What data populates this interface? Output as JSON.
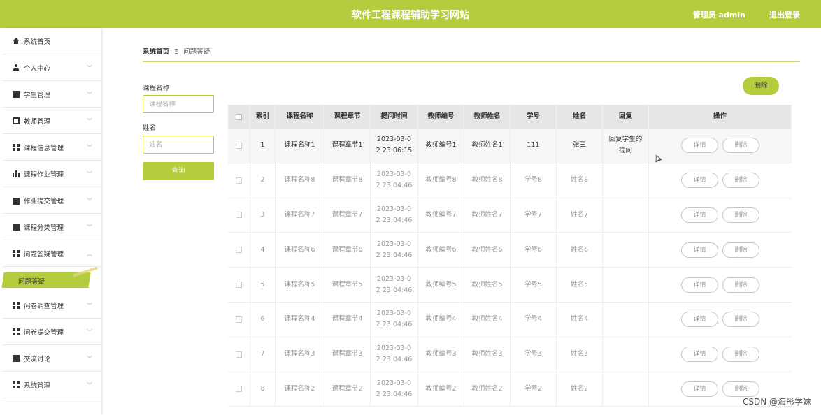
{
  "header": {
    "title": "软件工程课程辅助学习网站",
    "admin_label": "管理员 admin",
    "logout_label": "退出登录"
  },
  "sidebar": {
    "items": [
      {
        "label": "系统首页"
      },
      {
        "label": "个人中心"
      },
      {
        "label": "学生管理"
      },
      {
        "label": "教师管理"
      },
      {
        "label": "课程信息管理"
      },
      {
        "label": "课程作业管理"
      },
      {
        "label": "作业提交管理"
      },
      {
        "label": "课程分类管理"
      },
      {
        "label": "问题答疑管理"
      },
      {
        "label": "问卷调查管理"
      },
      {
        "label": "问卷提交管理"
      },
      {
        "label": "交流讨论"
      },
      {
        "label": "系统管理"
      }
    ],
    "active_sub": "问题答疑"
  },
  "breadcrumb": {
    "home": "系统首页",
    "separator": "Ξ",
    "current": "问题答疑"
  },
  "search": {
    "course_label": "课程名称",
    "course_placeholder": "课程名称",
    "name_label": "姓名",
    "name_placeholder": "姓名",
    "button": "查询"
  },
  "toolbar": {
    "delete_label": "删除"
  },
  "table": {
    "headers": [
      "",
      "索引",
      "课程名称",
      "课程章节",
      "提问时间",
      "教师编号",
      "教师姓名",
      "学号",
      "姓名",
      "回复",
      "操作"
    ],
    "detail_label": "详情",
    "delete_label": "删除",
    "rows": [
      {
        "index": "1",
        "course": "课程名称1",
        "chapter": "课程章节1",
        "time": "2023-03-0\n2 23:06:15",
        "teacher_no": "教师编号1",
        "teacher_name": "教师姓名1",
        "student_no": "111",
        "name": "张三",
        "reply": "回复学生的\n提问"
      },
      {
        "index": "2",
        "course": "课程名称8",
        "chapter": "课程章节8",
        "time": "2023-03-0\n2 23:04:46",
        "teacher_no": "教师编号8",
        "teacher_name": "教师姓名8",
        "student_no": "学号8",
        "name": "姓名8",
        "reply": ""
      },
      {
        "index": "3",
        "course": "课程名称7",
        "chapter": "课程章节7",
        "time": "2023-03-0\n2 23:04:46",
        "teacher_no": "教师编号7",
        "teacher_name": "教师姓名7",
        "student_no": "学号7",
        "name": "姓名7",
        "reply": ""
      },
      {
        "index": "4",
        "course": "课程名称6",
        "chapter": "课程章节6",
        "time": "2023-03-0\n2 23:04:46",
        "teacher_no": "教师编号6",
        "teacher_name": "教师姓名6",
        "student_no": "学号6",
        "name": "姓名6",
        "reply": ""
      },
      {
        "index": "5",
        "course": "课程名称5",
        "chapter": "课程章节5",
        "time": "2023-03-0\n2 23:04:46",
        "teacher_no": "教师编号5",
        "teacher_name": "教师姓名5",
        "student_no": "学号5",
        "name": "姓名5",
        "reply": ""
      },
      {
        "index": "6",
        "course": "课程名称4",
        "chapter": "课程章节4",
        "time": "2023-03-0\n2 23:04:46",
        "teacher_no": "教师编号4",
        "teacher_name": "教师姓名4",
        "student_no": "学号4",
        "name": "姓名4",
        "reply": ""
      },
      {
        "index": "7",
        "course": "课程名称3",
        "chapter": "课程章节3",
        "time": "2023-03-0\n2 23:04:46",
        "teacher_no": "教师编号3",
        "teacher_name": "教师姓名3",
        "student_no": "学号3",
        "name": "姓名3",
        "reply": ""
      },
      {
        "index": "8",
        "course": "课程名称2",
        "chapter": "课程章节2",
        "time": "2023-03-0\n2 23:04:46",
        "teacher_no": "教师编号2",
        "teacher_name": "教师姓名2",
        "student_no": "学号2",
        "name": "姓名2",
        "reply": ""
      }
    ]
  },
  "watermark": "CSDN @海彤学妹",
  "colors": {
    "accent": "#b3cd3f",
    "header_bg": "#e6e6e6"
  }
}
